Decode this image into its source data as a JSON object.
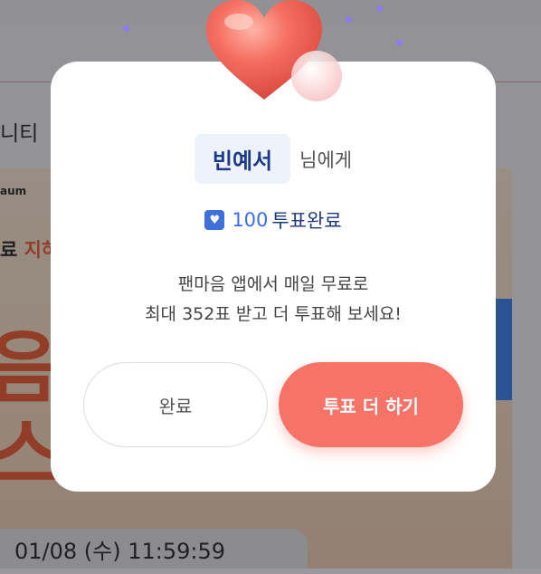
{
  "background": {
    "community_label": "니티",
    "banner_logo": "aum",
    "banner_line1_prefix": "료 ",
    "banner_line1_highlight": "지하",
    "banner_big1": "음이",
    "banner_big2": "스타",
    "date_label": "01/08 (수) 11:59:59"
  },
  "modal": {
    "recipient_name": "빈예서",
    "recipient_suffix": "님에게",
    "vote_count": "100",
    "vote_status": "투표완료",
    "message_line1": "팬마음 앱에서 매일 무료로",
    "message_line2": "최대 352표 받고 더 투표해 보세요!",
    "done_button": "완료",
    "more_button": "투표 더 하기"
  },
  "icons": {
    "heart": "heart-icon",
    "vote": "vote-heart-icon"
  },
  "colors": {
    "accent": "#f67368",
    "name_text": "#1b3a8a",
    "vote_count": "#3a6ee8"
  }
}
